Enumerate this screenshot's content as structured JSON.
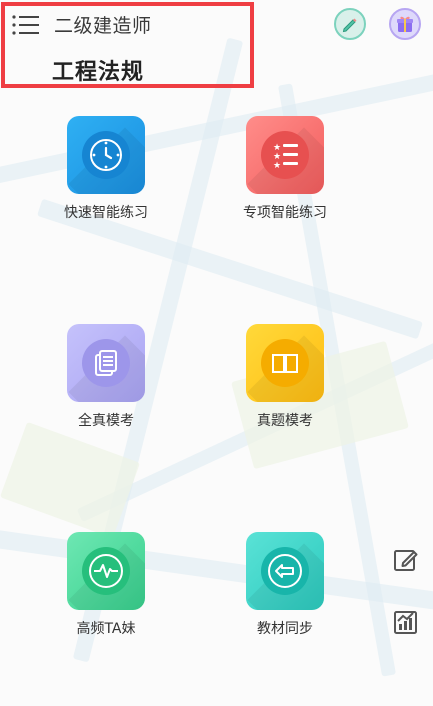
{
  "header": {
    "exam_name": "二级建造师",
    "subject_name": "工程法规",
    "icons": {
      "menu": "menu-icon",
      "pencil": "pencil-icon",
      "gift": "gift-icon"
    }
  },
  "tiles": [
    {
      "label": "快速智能练习",
      "icon": "clock-icon",
      "color": "#1f9cec"
    },
    {
      "label": "专项智能练习",
      "icon": "list-star-icon",
      "color": "#f56b69"
    },
    {
      "label": "全真模考",
      "icon": "document-icon",
      "color": "#aaa4f4"
    },
    {
      "label": "真题模考",
      "icon": "book-icon",
      "color": "#ffc21c"
    },
    {
      "label": "高频TA妹",
      "icon": "pulse-icon",
      "color": "#42d597"
    },
    {
      "label": "教材同步",
      "icon": "arrow-left-icon",
      "color": "#33cec2"
    }
  ],
  "side_buttons": [
    {
      "icon": "edit-icon"
    },
    {
      "icon": "chart-icon"
    }
  ],
  "colors": {
    "highlight": "#ef3e43"
  }
}
